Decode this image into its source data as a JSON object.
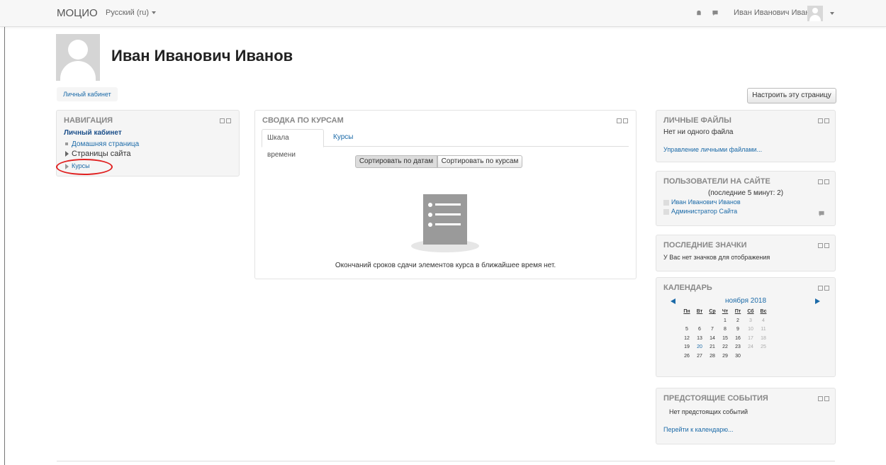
{
  "topbar": {
    "brand": "МОЦИО",
    "language": "Русский (ru)",
    "user_name": "Иван Иванович Иванов",
    "icons": [
      "notifications-icon",
      "messages-icon"
    ]
  },
  "profile": {
    "name": "Иван Иванович Иванов"
  },
  "breadcrumb": {
    "item": "Личный кабинет"
  },
  "customize_button": "Настроить эту страницу",
  "navigation": {
    "title": "НАВИГАЦИЯ",
    "root": "Личный кабинет",
    "items": [
      {
        "label": "Домашняя страница",
        "type": "link"
      },
      {
        "label": "Страницы сайта",
        "type": "branch"
      },
      {
        "label": "Курсы",
        "type": "branch-link",
        "highlighted": true
      }
    ]
  },
  "course_overview": {
    "title": "СВОДКА ПО КУРСАМ",
    "tabs": [
      "Шкала времени",
      "Курсы"
    ],
    "active_tab": 0,
    "sort_buttons": [
      "Сортировать по датам",
      "Сортировать по курсам"
    ],
    "empty_message": "Окончаний сроков сдачи элементов курса в ближайшее время нет."
  },
  "private_files": {
    "title": "ЛИЧНЫЕ ФАЙЛЫ",
    "text": "Нет ни одного файла",
    "link": "Управление личными файлами..."
  },
  "online_users": {
    "title": "ПОЛЬЗОВАТЕЛИ НА САЙТЕ",
    "subtitle": "(последние 5 минут: 2)",
    "users": [
      "Иван Иванович Иванов",
      "Администратор Сайта"
    ]
  },
  "latest_badges": {
    "title": "ПОСЛЕДНИЕ ЗНАЧКИ",
    "text": "У Вас нет значков для отображения"
  },
  "calendar": {
    "title": "КАЛЕНДАРЬ",
    "month": "ноября 2018",
    "weekdays": [
      "Пн",
      "Вт",
      "Ср",
      "Чт",
      "Пт",
      "Сб",
      "Вс"
    ],
    "weeks": [
      [
        "",
        "",
        "",
        "1",
        "2",
        "3",
        "4"
      ],
      [
        "5",
        "6",
        "7",
        "8",
        "9",
        "10",
        "11"
      ],
      [
        "12",
        "13",
        "14",
        "15",
        "16",
        "17",
        "18"
      ],
      [
        "19",
        "20",
        "21",
        "22",
        "23",
        "24",
        "25"
      ],
      [
        "26",
        "27",
        "28",
        "29",
        "30",
        "",
        ""
      ]
    ],
    "today": "20"
  },
  "upcoming_events": {
    "title": "ПРЕДСТОЯЩИЕ СОБЫТИЯ",
    "text": "Нет предстоящих событий",
    "link": "Перейти к календарю..."
  },
  "colors": {
    "link": "#1b6aa8",
    "highlight": "#e02020",
    "header_text": "#888888"
  }
}
